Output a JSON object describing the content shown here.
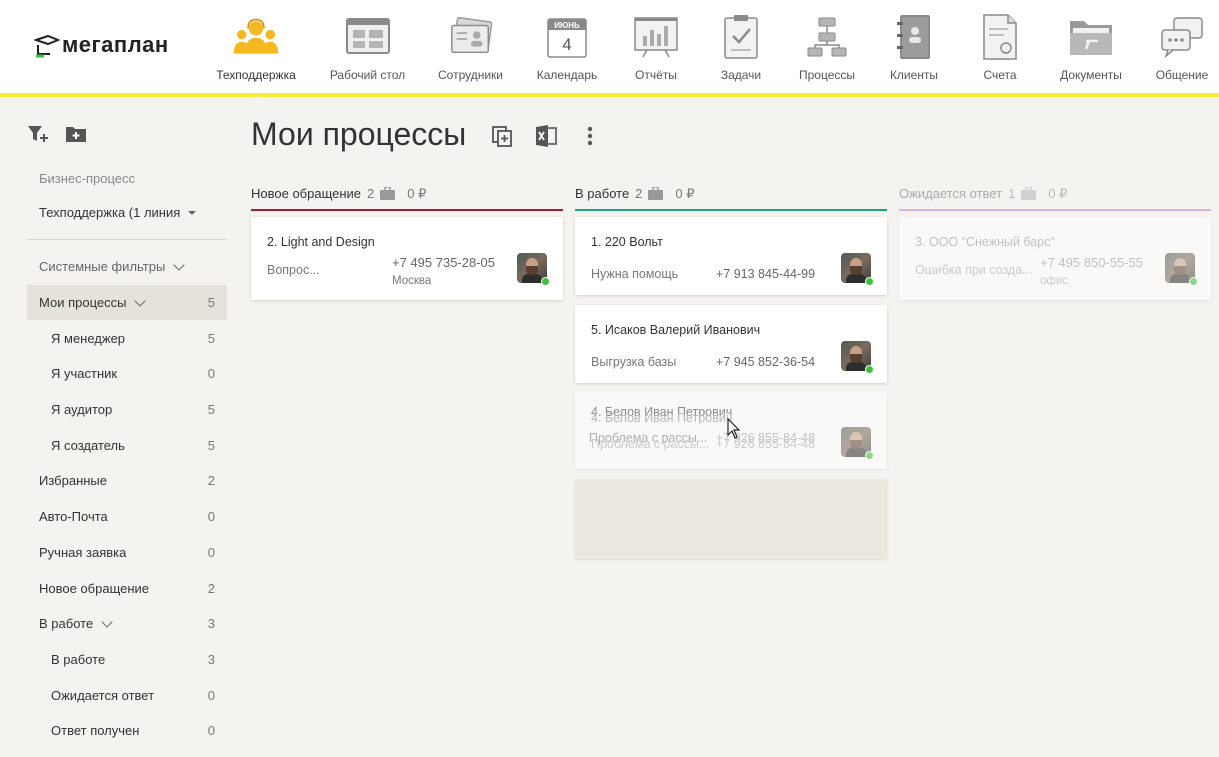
{
  "logo": {
    "text": "мегаплан"
  },
  "nav": [
    {
      "label": "Техподдержка",
      "icon": "support-team-icon",
      "active": true
    },
    {
      "label": "Рабочий стол",
      "icon": "desktop-icon"
    },
    {
      "label": "Сотрудники",
      "icon": "employees-icon"
    },
    {
      "label": "Календарь",
      "icon": "calendar-icon",
      "month": "ИЮНЬ",
      "day": "4"
    },
    {
      "label": "Отчёты",
      "icon": "reports-icon"
    },
    {
      "label": "Задачи",
      "icon": "tasks-icon"
    },
    {
      "label": "Процессы",
      "icon": "processes-icon"
    },
    {
      "label": "Клиенты",
      "icon": "clients-icon"
    },
    {
      "label": "Счета",
      "icon": "invoices-icon"
    },
    {
      "label": "Документы",
      "icon": "documents-icon"
    },
    {
      "label": "Общение",
      "icon": "chat-icon"
    }
  ],
  "sidebar": {
    "caption": "Бизнес-процесс",
    "select_value": "Техподдержка (1 линия",
    "items": [
      {
        "label": "Системные фильтры",
        "count": "",
        "chev": true,
        "sub": false,
        "gray": true
      },
      {
        "label": "Мои процессы",
        "count": "5",
        "chev": true,
        "sub": false,
        "active": true
      },
      {
        "label": "Я менеджер",
        "count": "5",
        "sub": true
      },
      {
        "label": "Я участник",
        "count": "0",
        "sub": true
      },
      {
        "label": "Я аудитор",
        "count": "5",
        "sub": true
      },
      {
        "label": "Я создатель",
        "count": "5",
        "sub": true
      },
      {
        "label": "Избранные",
        "count": "2",
        "sub": false
      },
      {
        "label": "Авто-Почта",
        "count": "0",
        "sub": false
      },
      {
        "label": "Ручная заявка",
        "count": "0",
        "sub": false
      },
      {
        "label": "Новое обращение",
        "count": "2",
        "sub": false
      },
      {
        "label": "В работе",
        "count": "3",
        "chev": true,
        "sub": false
      },
      {
        "label": "В работе",
        "count": "3",
        "sub": true
      },
      {
        "label": "Ожидается ответ",
        "count": "0",
        "sub": true
      },
      {
        "label": "Ответ получен",
        "count": "0",
        "sub": true
      }
    ]
  },
  "main": {
    "title": "Мои процессы",
    "columns": [
      {
        "name": "Новое обращение",
        "count": "2",
        "money": "0 ₽",
        "color": "#a0203a",
        "cards": [
          {
            "title": "2. Light and Design",
            "desc": "Вопрос...",
            "phone": "+7 495 735-28-05",
            "city": "Москва"
          }
        ]
      },
      {
        "name": "В работе",
        "count": "2",
        "money": "0 ₽",
        "color": "#1ea37a",
        "cards": [
          {
            "title": "1. 220 Вольт",
            "desc": "Нужна помощь",
            "phone": "+7 913 845-44-99",
            "city": ""
          },
          {
            "title": "5. Исаков Валерий Иванович",
            "desc": "Выгрузка базы",
            "phone": "+7 945 852-36-54",
            "city": ""
          },
          {
            "title": "4. Белов Иван Петрович",
            "desc": "Проблема с рассы...",
            "phone": "+7 926 855-84-48",
            "city": ""
          }
        ]
      },
      {
        "name": "Ожидается ответ",
        "count": "1",
        "money": "0 ₽",
        "color": "#d9b3e8",
        "cards": [
          {
            "title": "3. ООО \"Снежный барс\"",
            "desc": "Ошибка при созда...",
            "phone": "+7 495 850-55-55",
            "city": "офис"
          }
        ]
      }
    ]
  }
}
